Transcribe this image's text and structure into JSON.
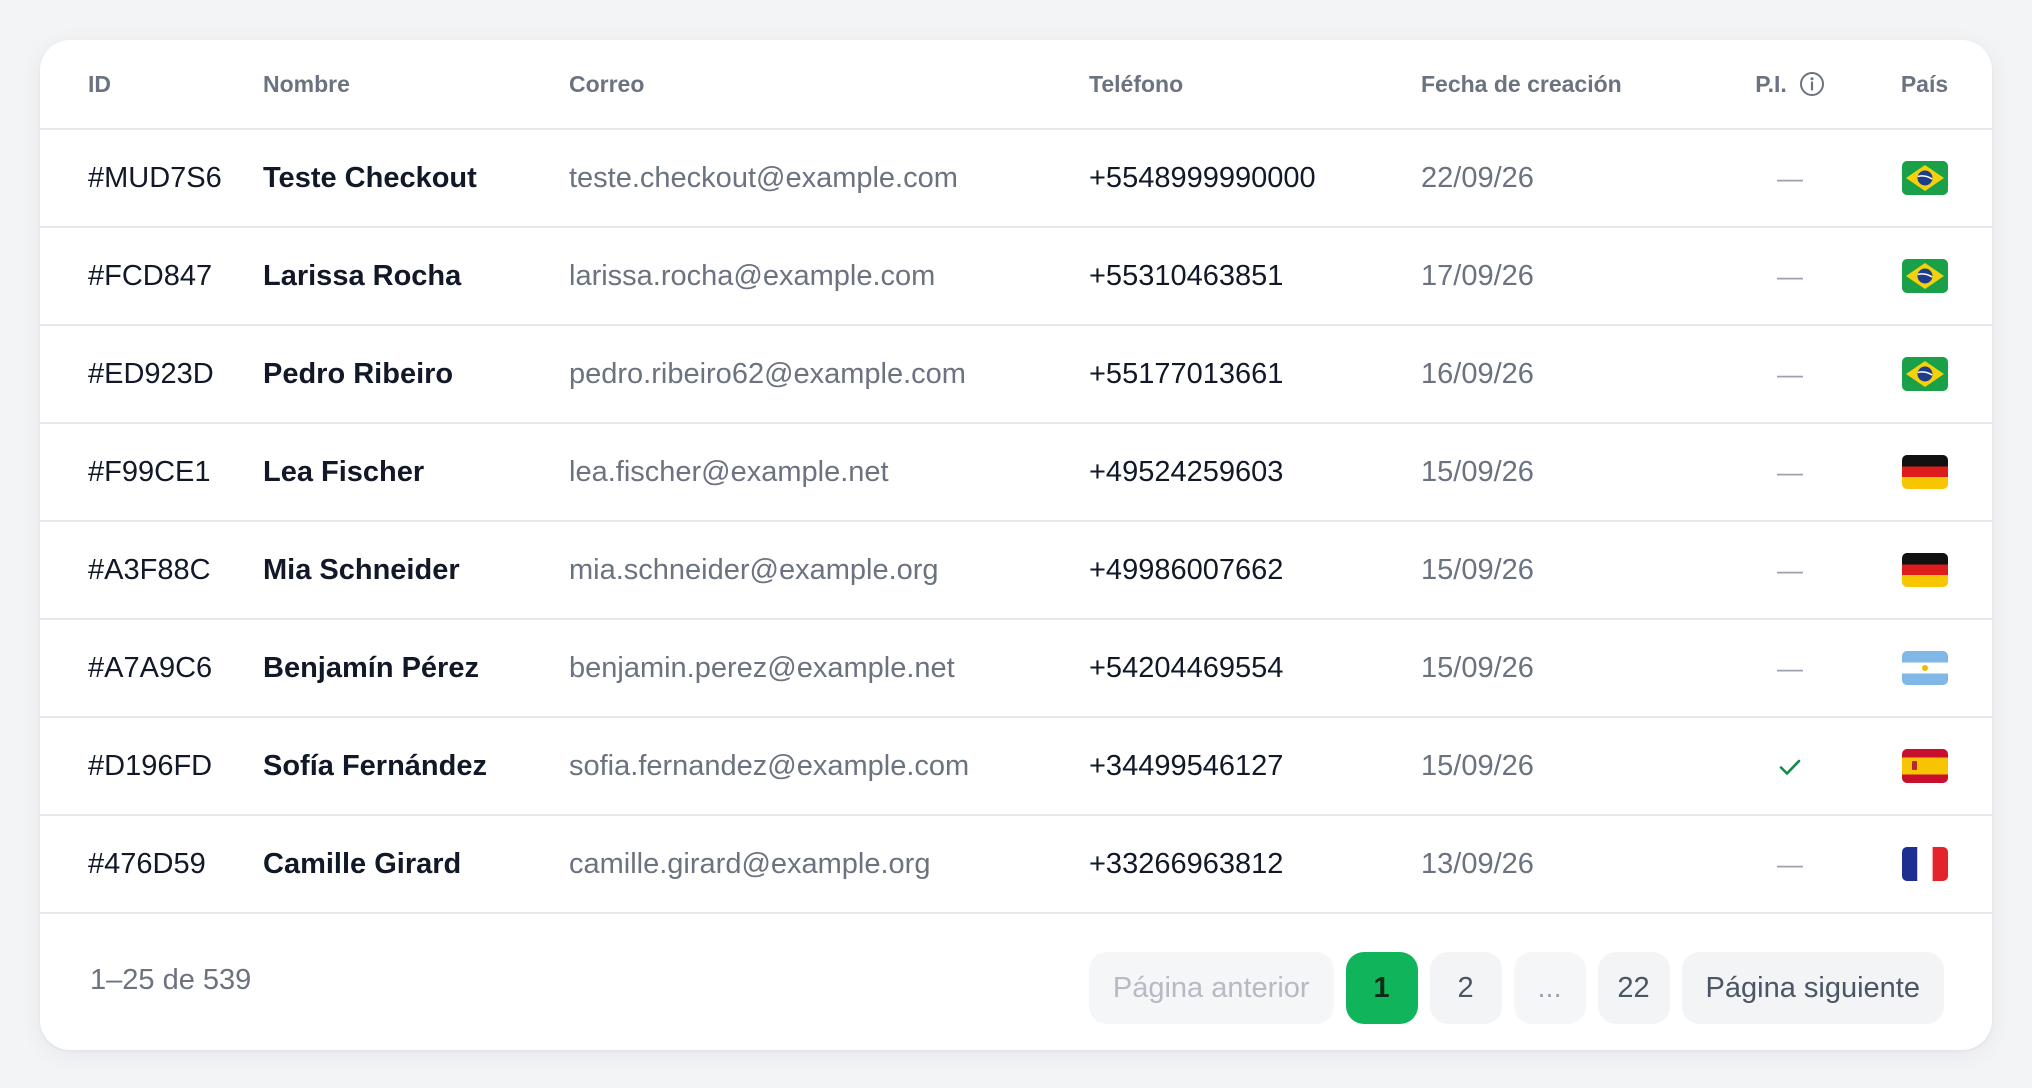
{
  "table": {
    "headers": {
      "id": "ID",
      "name": "Nombre",
      "email": "Correo",
      "phone": "Teléfono",
      "created": "Fecha de creación",
      "pi": "P.I.",
      "country": "País"
    },
    "rows": [
      {
        "id": "#MUD7S6",
        "name": "Teste Checkout",
        "email": "teste.checkout@example.com",
        "phone": "+5548999990000",
        "created": "22/09/26",
        "pi": "—",
        "pi_checked": false,
        "country": "brazil-flag-icon"
      },
      {
        "id": "#FCD847",
        "name": "Larissa Rocha",
        "email": "larissa.rocha@example.com",
        "phone": "+55310463851",
        "created": "17/09/26",
        "pi": "—",
        "pi_checked": false,
        "country": "brazil-flag-icon"
      },
      {
        "id": "#ED923D",
        "name": "Pedro Ribeiro",
        "email": "pedro.ribeiro62@example.com",
        "phone": "+55177013661",
        "created": "16/09/26",
        "pi": "—",
        "pi_checked": false,
        "country": "brazil-flag-icon"
      },
      {
        "id": "#F99CE1",
        "name": "Lea Fischer",
        "email": "lea.fischer@example.net",
        "phone": "+49524259603",
        "created": "15/09/26",
        "pi": "—",
        "pi_checked": false,
        "country": "germany-flag-icon"
      },
      {
        "id": "#A3F88C",
        "name": "Mia Schneider",
        "email": "mia.schneider@example.org",
        "phone": "+49986007662",
        "created": "15/09/26",
        "pi": "—",
        "pi_checked": false,
        "country": "germany-flag-icon"
      },
      {
        "id": "#A7A9C6",
        "name": "Benjamín Pérez",
        "email": "benjamin.perez@example.net",
        "phone": "+54204469554",
        "created": "15/09/26",
        "pi": "—",
        "pi_checked": false,
        "country": "argentina-flag-icon"
      },
      {
        "id": "#D196FD",
        "name": "Sofía Fernández",
        "email": "sofia.fernandez@example.com",
        "phone": "+34499546127",
        "created": "15/09/26",
        "pi": "",
        "pi_checked": true,
        "country": "spain-flag-icon"
      },
      {
        "id": "#476D59",
        "name": "Camille Girard",
        "email": "camille.girard@example.org",
        "phone": "+33266963812",
        "created": "13/09/26",
        "pi": "—",
        "pi_checked": false,
        "country": "france-flag-icon"
      }
    ]
  },
  "pagination": {
    "range_label": "1–25 de 539",
    "prev_label": "Página anterior",
    "pages": [
      "1",
      "2",
      "...",
      "22"
    ],
    "current_page": "1",
    "next_label": "Página siguiente"
  },
  "colors": {
    "accent": "#10b45a",
    "check": "#0f8a4a",
    "muted_text": "#6b7280",
    "border": "#e5e7eb"
  },
  "icons": {
    "info": "info-icon",
    "check": "check-icon"
  }
}
